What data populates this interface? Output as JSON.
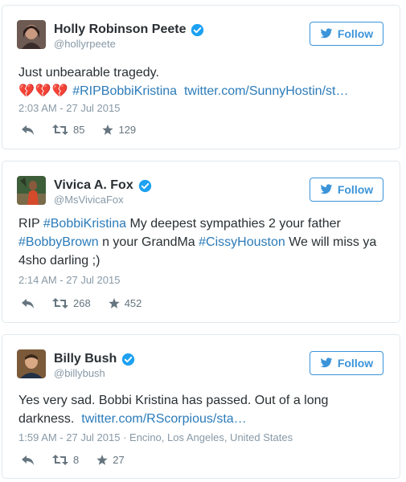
{
  "tweets": [
    {
      "name": "Holly Robinson Peete",
      "handle": "@hollyrpeete",
      "follow_label": "Follow",
      "line1": "Just unbearable tragedy.",
      "line2_emoji": "💔💔💔",
      "hashtag": "#RIPBobbiKristina",
      "link": "twitter.com/SunnyHostin/st…",
      "time": "2:03 AM - 27 Jul 2015",
      "retweets": "85",
      "favorites": "129"
    },
    {
      "name": "Vivica A. Fox",
      "handle": "@MsVivicaFox",
      "follow_label": "Follow",
      "rip": "RIP",
      "tag1": "#BobbiKristina",
      "t1": "My deepest sympathies 2 your father",
      "tag2": "#BobbyBrown",
      "t2": "n your GrandMa",
      "tag3": "#CissyHouston",
      "t3": "We will miss ya",
      "line3": "4sho darling ;)",
      "time": "2:14 AM - 27 Jul 2015",
      "retweets": "268",
      "favorites": "452"
    },
    {
      "name": "Billy Bush",
      "handle": "@billybush",
      "follow_label": "Follow",
      "line1": "Yes very sad. Bobbi Kristina has passed. Out of a long",
      "line2": "darkness.",
      "link": "twitter.com/RScorpious/sta…",
      "time": "1:59 AM - 27 Jul 2015 · Encino, Los Angeles, United States",
      "retweets": "8",
      "favorites": "27"
    }
  ],
  "colors": {
    "link": "#2b7bb9",
    "verified": "#1da1f2",
    "follow": "#3b94d9",
    "muted": "#8899a6"
  },
  "icons": [
    "verified-badge-icon",
    "twitter-bird-icon",
    "reply-icon",
    "retweet-icon",
    "favorite-star-icon",
    "broken-heart-icon"
  ]
}
